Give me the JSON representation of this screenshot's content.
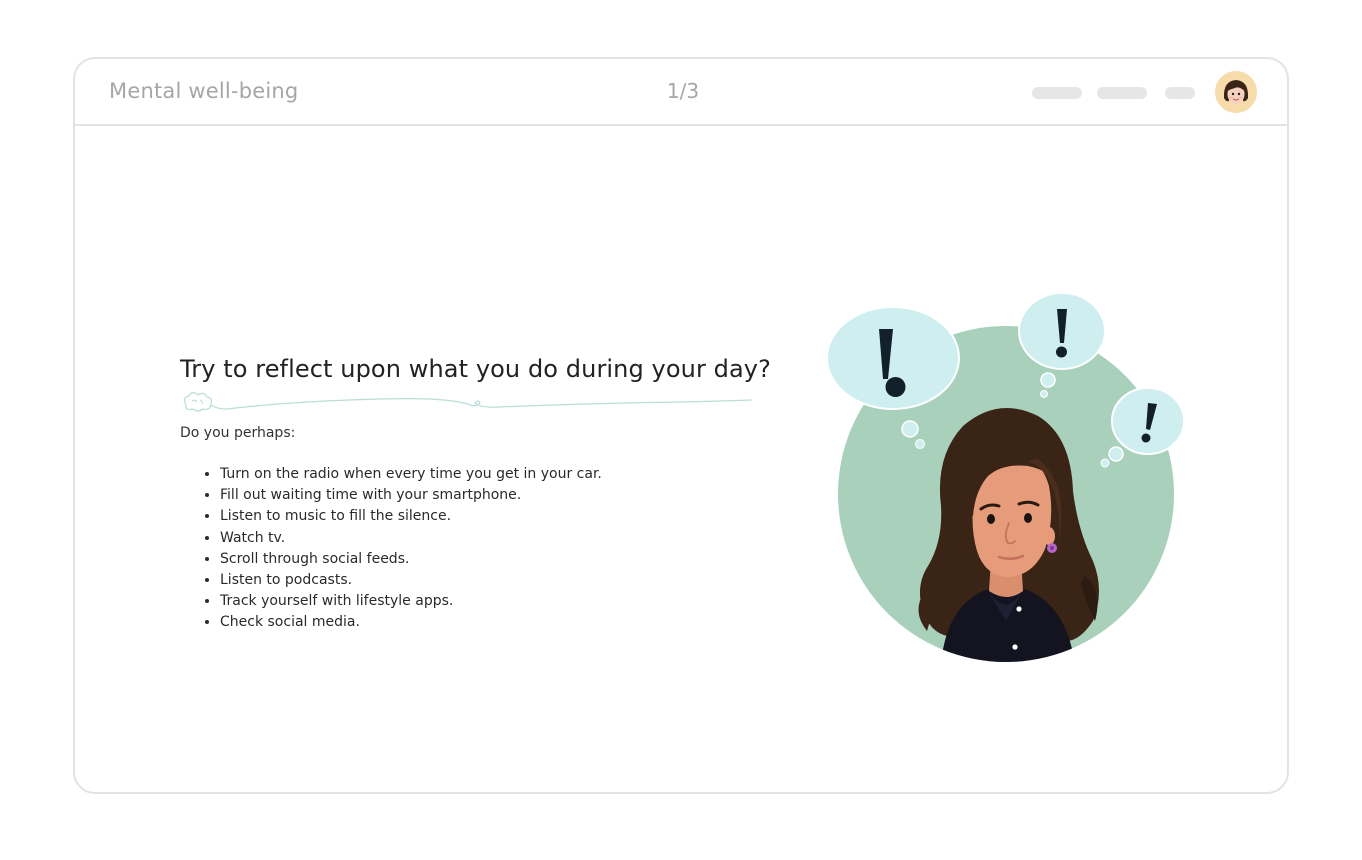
{
  "header": {
    "app_title": "Mental well-being",
    "page_counter": "1/3"
  },
  "content": {
    "heading": "Try to reflect upon what you do during your day?",
    "intro": "Do you perhaps:",
    "tips": [
      "Turn on the radio when every time you get in your car.",
      "Fill out waiting time with your smartphone.",
      "Listen to music to fill the silence.",
      "Watch tv.",
      "Scroll through social feeds.",
      "Listen to podcasts.",
      "Track yourself with lifestyle apps.",
      "Check social media."
    ]
  },
  "illustration": {
    "subject": "woman-with-exclamation-thought-bubbles",
    "bubble_marks": [
      "!",
      "!",
      "!"
    ]
  },
  "colors": {
    "frame_border": "#e3e3e3",
    "muted_text": "#a6a6a6",
    "circle_bg": "#a9d0bb",
    "bubble_bg": "#cfeef0",
    "mark_dark": "#12202c",
    "hair": "#3a2416",
    "skin": "#e69c7a",
    "shirt": "#131420",
    "avatar_bg": "#f7dca9"
  }
}
